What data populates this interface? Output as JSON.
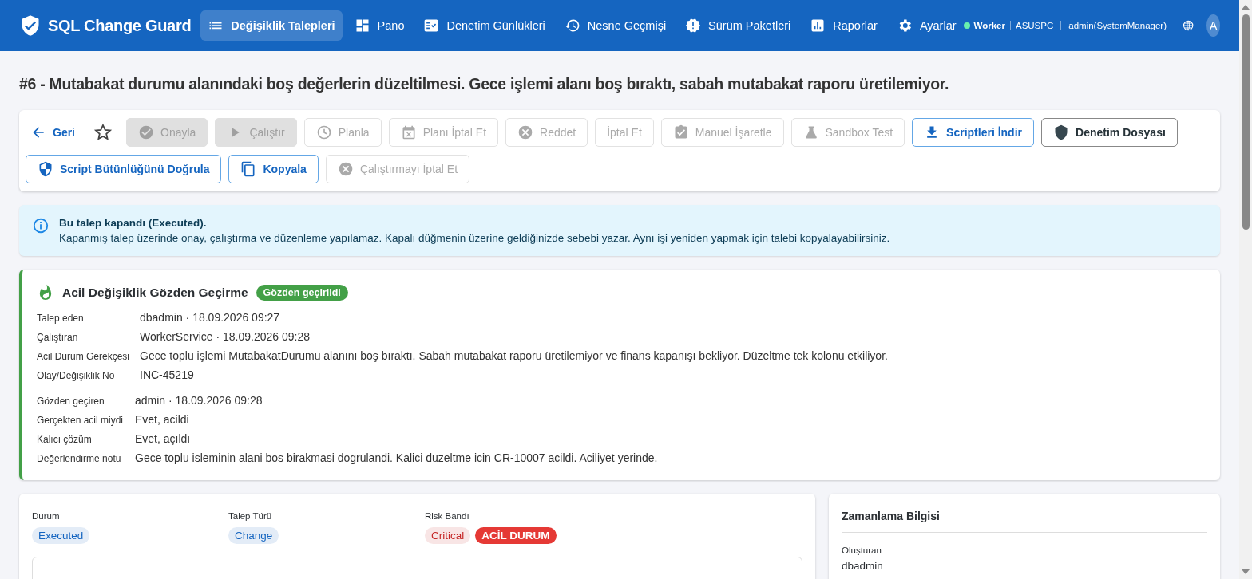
{
  "app": {
    "title": "SQL Change Guard"
  },
  "nav": [
    {
      "label": "Değişiklik Talepleri",
      "selected": true
    },
    {
      "label": "Pano",
      "selected": false
    },
    {
      "label": "Denetim Günlükleri",
      "selected": false
    },
    {
      "label": "Nesne Geçmişi",
      "selected": false
    },
    {
      "label": "Sürüm Paketleri",
      "selected": false
    },
    {
      "label": "Raporlar",
      "selected": false
    },
    {
      "label": "Ayarlar",
      "selected": false
    }
  ],
  "status": {
    "worker": "Worker",
    "online": true,
    "host": "ASUSPC",
    "user": "admin(SystemManager)"
  },
  "avatar": "A",
  "page_title": "#6 - Mutabakat durumu alanındaki boş değerlerin düzeltilmesi. Gece işlemi alanı boş bıraktı, sabah mutabakat raporu üretilemiyor.",
  "toolbar": [
    {
      "kind": "link",
      "label": "Geri",
      "disabled": false
    },
    {
      "kind": "star"
    },
    {
      "kind": "filled",
      "label": "Onayla",
      "disabled": true
    },
    {
      "kind": "filled",
      "label": "Çalıştır",
      "disabled": true
    },
    {
      "kind": "outline",
      "label": "Planla",
      "disabled": true
    },
    {
      "kind": "outline",
      "label": "Planı İptal Et",
      "disabled": true
    },
    {
      "kind": "outline",
      "label": "Reddet",
      "disabled": true
    },
    {
      "kind": "outline",
      "label": "İptal Et",
      "disabled": true
    },
    {
      "kind": "outline",
      "label": "Manuel İşaretle",
      "disabled": true
    },
    {
      "kind": "outline",
      "label": "Sandbox Test",
      "disabled": true
    },
    {
      "kind": "primary",
      "label": "Scriptleri İndir",
      "disabled": false
    },
    {
      "kind": "dark",
      "label": "Denetim Dosyası",
      "disabled": false
    },
    {
      "kind": "primary",
      "label": "Script Bütünlüğünü Doğrula",
      "disabled": false
    },
    {
      "kind": "primary",
      "label": "Kopyala",
      "disabled": false
    },
    {
      "kind": "outline",
      "label": "Çalıştırmayı İptal Et",
      "disabled": true
    }
  ],
  "alert": {
    "title": "Bu talep kapandı (Executed).",
    "text": "Kapanmış talep üzerinde onay, çalıştırma ve düzenleme yapılamaz. Kapalı düğmenin üzerine geldiğinizde sebebi yazar. Aynı işi yeniden yapmak için talebi kopyalayabilirsiniz."
  },
  "emergency_review": {
    "title": "Acil Değişiklik Gözden Geçirme",
    "badge": "Gözden geçirildi",
    "request_fields": [
      {
        "label": "Talep eden",
        "value": "dbadmin · 18.09.2026 09:27"
      },
      {
        "label": "Çalıştıran",
        "value": "WorkerService · 18.09.2026 09:28"
      },
      {
        "label": "Acil Durum Gerekçesi",
        "value": "Gece toplu işlemi MutabakatDurumu alanını boş bıraktı. Sabah mutabakat raporu üretilemiyor ve finans kapanışı bekliyor. Düzeltme tek kolonu etkiliyor."
      },
      {
        "label": "Olay/Değişiklik No",
        "value": "INC-45219"
      }
    ],
    "review_fields": [
      {
        "label": "Gözden geçiren",
        "value": "admin · 18.09.2026 09:28"
      },
      {
        "label": "Gerçekten acil miydi",
        "value": "Evet, acildi"
      },
      {
        "label": "Kalıcı çözüm",
        "value": "Evet, açıldı"
      },
      {
        "label": "Değerlendirme notu",
        "value": "Gece toplu isleminin alani bos birakmasi dogrulandi. Kalici duzeltme icin CR-10007 acildi. Aciliyet yerinde."
      }
    ]
  },
  "details": [
    {
      "label": "Durum",
      "badges": [
        {
          "text": "Executed",
          "kind": "soft",
          "color": "#1565c0"
        }
      ]
    },
    {
      "label": "Talep Türü",
      "badges": [
        {
          "text": "Change",
          "kind": "soft",
          "color": "#1565c0"
        }
      ]
    },
    {
      "label": "Risk Bandı",
      "badges": [
        {
          "text": "Critical",
          "kind": "soft",
          "color": "#c62828"
        },
        {
          "text": "ACİL DURUM",
          "kind": "solid",
          "color": "#e53935"
        }
      ]
    }
  ],
  "timing": {
    "title": "Zamanlama Bilgisi",
    "fields": [
      {
        "label": "Oluşturan",
        "value": "dbadmin"
      }
    ]
  }
}
